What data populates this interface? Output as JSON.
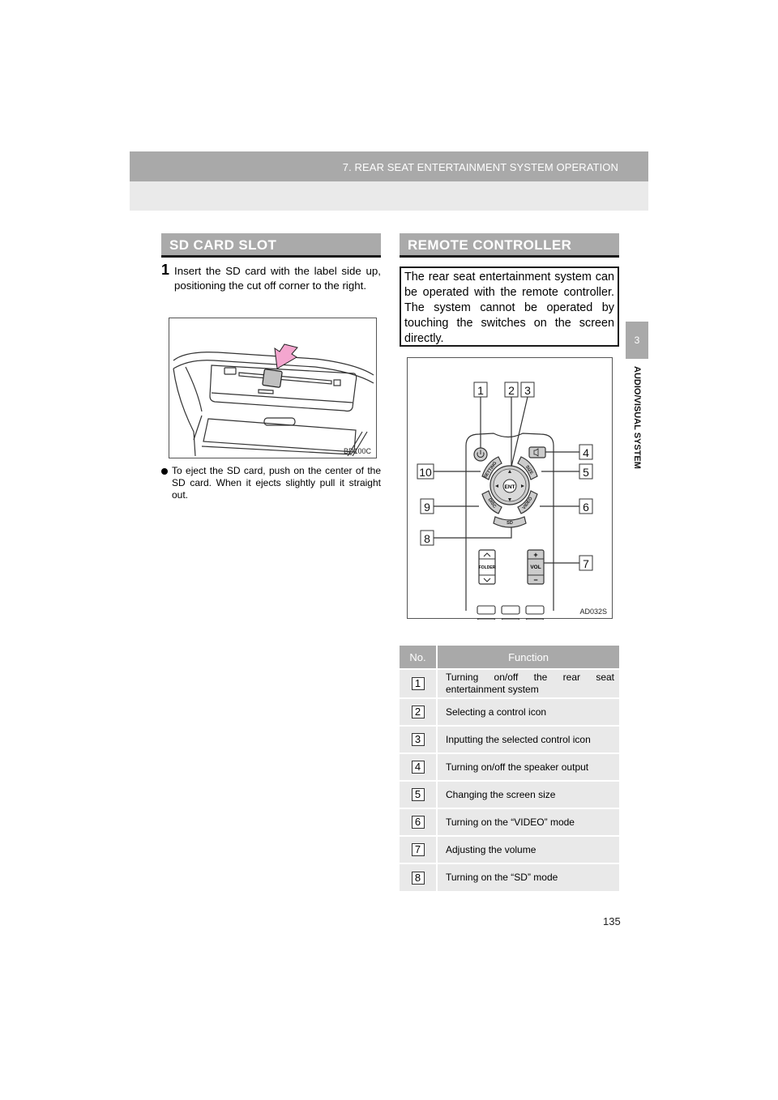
{
  "header": {
    "chapter_title": "7. REAR SEAT ENTERTAINMENT SYSTEM OPERATION"
  },
  "side_tab": {
    "number": "3",
    "label": "AUDIO/VISUAL SYSTEM"
  },
  "sd_card_slot": {
    "heading": "SD CARD SLOT",
    "step_number": "1",
    "step_text": "Insert the SD card with the label side up, positioning the cut off corner to the right.",
    "figure_code": "BD100C",
    "bullet_text": "To eject the SD card, push on the center of the SD card. When it ejects slightly pull it straight out."
  },
  "remote_controller": {
    "heading": "REMOTE CONTROLLER",
    "note_text": "The rear seat entertainment system can be operated with the remote controller. The system cannot be operated by touching the switches on the screen directly.",
    "figure_code": "AD032S",
    "callouts": [
      "1",
      "2",
      "3",
      "4",
      "5",
      "6",
      "7",
      "8",
      "9",
      "10"
    ],
    "buttons": {
      "enter": "ENT",
      "setting": "SETTING",
      "size": "SIZE",
      "disc": "DISC",
      "video": "VIDEO",
      "sd": "SD",
      "folder": "FOLDER",
      "volume": "VOL",
      "plus": "+",
      "minus": "−",
      "up": "^",
      "down": "v"
    }
  },
  "function_table": {
    "headers": [
      "No.",
      "Function"
    ],
    "rows": [
      {
        "no": "1",
        "function": "Turning on/off the rear seat entertainment system"
      },
      {
        "no": "2",
        "function": "Selecting a control icon"
      },
      {
        "no": "3",
        "function": "Inputting the selected control icon"
      },
      {
        "no": "4",
        "function": "Turning on/off the speaker output"
      },
      {
        "no": "5",
        "function": "Changing the screen size"
      },
      {
        "no": "6",
        "function": "Turning on the “VIDEO” mode"
      },
      {
        "no": "7",
        "function": "Adjusting the volume"
      },
      {
        "no": "8",
        "function": "Turning on the “SD” mode"
      }
    ]
  },
  "page_number": "135"
}
